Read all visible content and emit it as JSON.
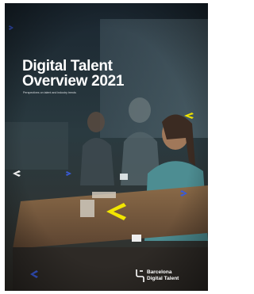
{
  "cover": {
    "title_line1": "Digital Talent",
    "title_line2": "Overview 2021",
    "subtitle": "Perspectives on talent and industry trends",
    "logo": {
      "line1": "Barcelona",
      "line2": "Digital Talent"
    }
  },
  "colors": {
    "accent_yellow": "#f2e600",
    "accent_blue": "#3a5bd9",
    "text_white": "#ffffff",
    "overlay_dark": "#1c2b34"
  },
  "icons": [
    "chevron-left-icon",
    "chevron-right-icon",
    "barcelona-digital-talent-logo"
  ]
}
